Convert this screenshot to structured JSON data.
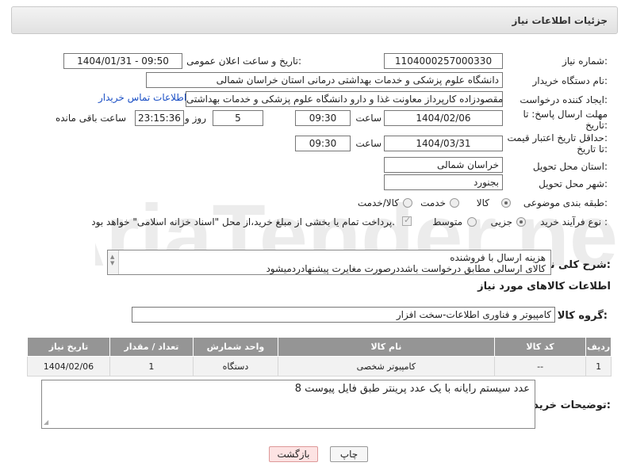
{
  "header": {
    "title": "جزئیات اطلاعات نیاز"
  },
  "form": {
    "need_number_label": "شماره نیاز:",
    "need_number": "1104000257000330",
    "announce_label": "تاریخ و ساعت اعلان عمومی:",
    "announce_value": "1404/01/31 - 09:50",
    "buyer_org_label": "نام دستگاه خریدار:",
    "buyer_org": "دانشگاه علوم پزشکی و خدمات بهداشتی درمانی استان خراسان شمالی",
    "creator_label": "ایجاد کننده درخواست:",
    "creator": "حامد مقصودزاده کارپرداز معاونت غذا و دارو دانشگاه علوم پزشکی و خدمات بهداشتی",
    "contact_link": "اطلاعات تماس خریدار",
    "deadline_label_1": "مهلت ارسال پاسخ: تا",
    "deadline_label_2": "تاریخ:",
    "deadline_date": "1404/02/06",
    "time_label": "ساعت",
    "deadline_time": "09:30",
    "days": "5",
    "days_label": "روز و",
    "remaining": "23:15:36",
    "remaining_label": "ساعت باقی مانده",
    "min_valid_label_1": "حداقل تاریخ اعتبار قیمت:",
    "min_valid_label_2": "تا تاریخ:",
    "valid_date": "1404/03/31",
    "valid_time": "09:30",
    "province_label": "استان محل تحویل:",
    "province": "خراسان شمالی",
    "city_label": "شهر محل تحویل:",
    "city": "بجنورد",
    "category_label": "طبقه بندی موضوعی:",
    "cat_goods": "کالا",
    "cat_service": "خدمت",
    "cat_both": "کالا/خدمت",
    "process_label": "نوع فرآیند خرید :",
    "proc_small": "جزیی",
    "proc_medium": "متوسط",
    "payment_note": "پرداخت تمام یا بخشی از مبلغ خرید،از محل \"اسناد خزانه اسلامی\" خواهد بود.",
    "general_desc_label": "شرح کلی نیاز:",
    "general_desc_line1": "هزینه ارسال با فروشنده",
    "general_desc_line2": "کالای ارسالی مطابق درخواست باشددرصورت مغایرت پیشنهادردمیشود",
    "goods_info_title": "اطلاعات کالاهای مورد نیاز",
    "goods_group_label": "گروه کالا:",
    "goods_group": "کامپیوتر و فناوری اطلاعات-سخت افزار",
    "buyer_notes_label": "توضیحات خریدار:",
    "buyer_notes": "8 عدد سیستم رایانه با یک عدد پرینتر طبق فایل پیوست"
  },
  "table": {
    "headers": [
      "ردیف",
      "کد کالا",
      "نام کالا",
      "واحد شمارش",
      "تعداد / مقدار",
      "تاریخ نیاز"
    ],
    "rows": [
      [
        "1",
        "--",
        "کامپیوتر شخصی",
        "دستگاه",
        "1",
        "1404/02/06"
      ]
    ]
  },
  "buttons": {
    "print": "چاپ",
    "back": "بازگشت"
  },
  "colors": {
    "link": "#1a4fc5",
    "table_header": "#959595",
    "back_button": "#fde3e3"
  },
  "watermark": {
    "text": "AriaTender.neT"
  }
}
